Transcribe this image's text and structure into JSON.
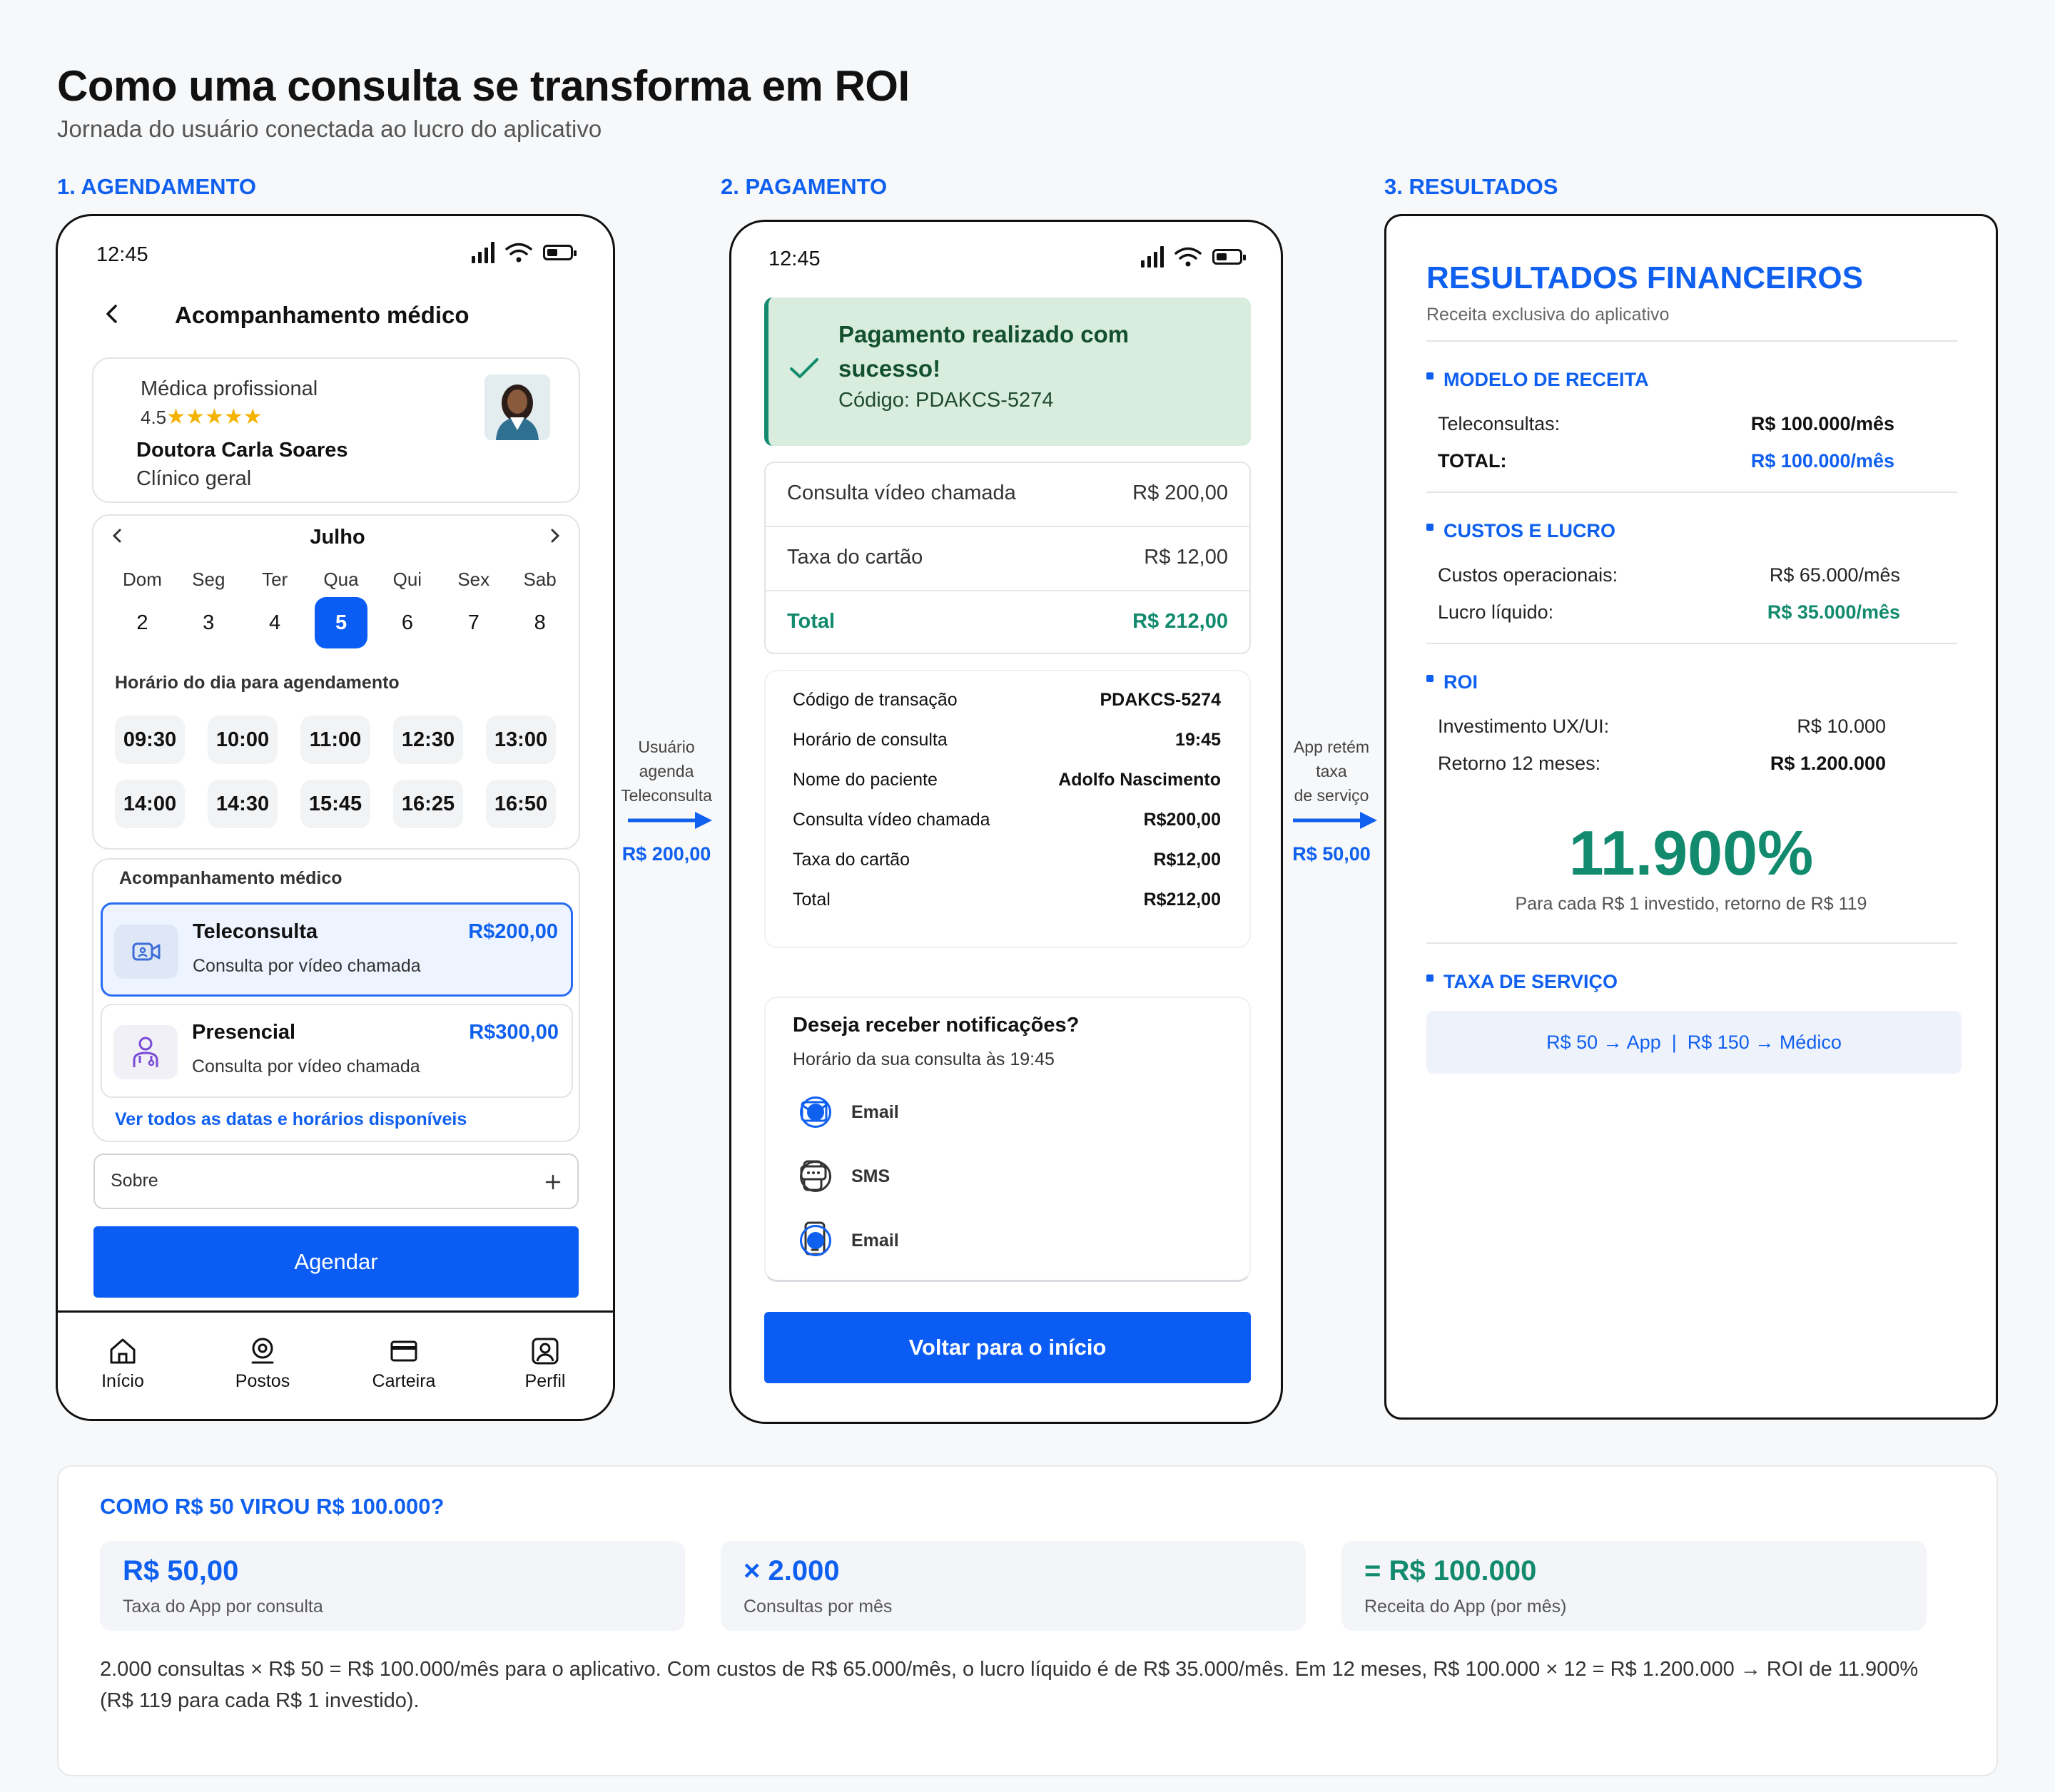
{
  "header": {
    "title": "Como uma consulta se transforma em ROI",
    "subtitle": "Jornada do usuário conectada ao lucro do aplicativo"
  },
  "steps": [
    "1. AGENDAMENTO",
    "2. PAGAMENTO",
    "3. RESULTADOS"
  ],
  "phone1": {
    "time": "12:45",
    "page_title": "Acompanhamento médico",
    "doctor": {
      "role": "Médica profissional",
      "rating": "4.5",
      "stars": "★★★★★",
      "name": "Doutora Carla Soares",
      "specialty": "Clínico geral"
    },
    "calendar": {
      "month": "Julho",
      "weekdays": [
        "Dom",
        "Seg",
        "Ter",
        "Qua",
        "Qui",
        "Sex",
        "Sab"
      ],
      "dates": [
        "2",
        "3",
        "4",
        "5",
        "6",
        "7",
        "8"
      ],
      "selected": "5"
    },
    "slots_label": "Horário do dia para agendamento",
    "slots": [
      "09:30",
      "10:00",
      "11:00",
      "12:30",
      "13:00",
      "14:00",
      "14:30",
      "15:45",
      "16:25",
      "16:50"
    ],
    "options_label": "Acompanhamento médico",
    "options": [
      {
        "title": "Teleconsulta",
        "price": "R$200,00",
        "desc": "Consulta por vídeo chamada"
      },
      {
        "title": "Presencial",
        "price": "R$300,00",
        "desc": "Consulta por vídeo chamada"
      }
    ],
    "see_all": "Ver todos as datas e horários disponíveis",
    "about": "Sobre",
    "button": "Agendar",
    "nav": [
      "Início",
      "Postos",
      "Carteira",
      "Perfil"
    ]
  },
  "connector1": {
    "lines": [
      "Usuário",
      "agenda",
      "Teleconsulta"
    ],
    "value": "R$ 200,00"
  },
  "connector2": {
    "lines": [
      "App retém",
      "taxa",
      "de serviço"
    ],
    "value": "R$ 50,00"
  },
  "phone2": {
    "time": "12:45",
    "success_title": "Pagamento realizado com sucesso!",
    "success_code": "Código: PDAKCS-5274",
    "summary": [
      {
        "label": "Consulta vídeo chamada",
        "value": "R$ 200,00"
      },
      {
        "label": "Taxa do cartão",
        "value": "R$ 12,00"
      }
    ],
    "total_label": "Total",
    "total_value": "R$ 212,00",
    "details": [
      {
        "label": "Código de transação",
        "value": "PDAKCS-5274"
      },
      {
        "label": "Horário de consulta",
        "value": "19:45"
      },
      {
        "label": "Nome do paciente",
        "value": "Adolfo Nascimento"
      },
      {
        "label": "Consulta vídeo chamada",
        "value": "R$200,00"
      },
      {
        "label": "Taxa do cartão",
        "value": "R$12,00"
      },
      {
        "label": "Total",
        "value": "R$212,00"
      }
    ],
    "notif_title": "Deseja receber notificações?",
    "notif_sub": "Horário da sua consulta às 19:45",
    "notif_options": [
      {
        "label": "Email",
        "checked": true
      },
      {
        "label": "SMS",
        "checked": false
      },
      {
        "label": "Email",
        "checked": true
      }
    ],
    "button": "Voltar para o início"
  },
  "results": {
    "title": "RESULTADOS FINANCEIROS",
    "subtitle": "Receita exclusiva do aplicativo",
    "revenue": {
      "heading": "MODELO DE RECEITA",
      "rows": [
        {
          "label": "Teleconsultas:",
          "value": "R$ 100.000/mês"
        },
        {
          "label": "TOTAL:",
          "value": "R$ 100.000/mês"
        }
      ]
    },
    "costs": {
      "heading": "CUSTOS E LUCRO",
      "rows": [
        {
          "label": "Custos operacionais:",
          "value": "R$ 65.000/mês"
        },
        {
          "label": "Lucro líquido:",
          "value": "R$ 35.000/mês"
        }
      ]
    },
    "roi": {
      "heading": "ROI",
      "rows": [
        {
          "label": "Investimento UX/UI:",
          "value": "R$ 10.000"
        },
        {
          "label": "Retorno 12 meses:",
          "value": "R$ 1.200.000"
        }
      ],
      "big": "11.900%",
      "caption": "Para cada R$ 1 investido, retorno de R$ 119"
    },
    "fee": {
      "heading": "TAXA DE SERVIÇO",
      "text": "R$ 50 → App  |  R$ 150 → Médico"
    }
  },
  "bottom": {
    "heading": "COMO R$ 50 VIROU R$ 100.000?",
    "stats": [
      {
        "value": "R$ 50,00",
        "label": "Taxa do App por consulta"
      },
      {
        "value": "× 2.000",
        "label": "Consultas por mês"
      },
      {
        "value": "= R$ 100.000",
        "label": "Receita do App (por mês)"
      }
    ],
    "explanation": "2.000 consultas × R$ 50 = R$ 100.000/mês para o aplicativo. Com custos de R$ 65.000/mês, o lucro líquido é de R$ 35.000/mês. Em 12 meses, R$ 100.000 × 12 = R$ 1.200.000 → ROI de 11.900% (R$ 119 para cada R$ 1 investido)."
  },
  "colors": {
    "accent": "#0a5cf5",
    "success": "#128a6e",
    "success_bg": "#d9eddf"
  }
}
